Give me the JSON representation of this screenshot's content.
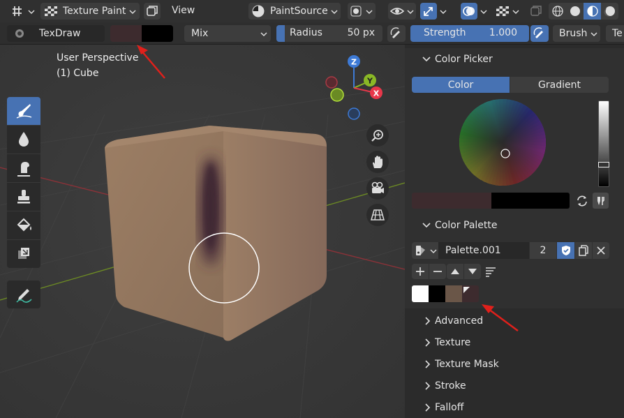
{
  "header": {
    "mode_label": "Texture Paint",
    "view_menu": "View",
    "source_label": "PaintSource"
  },
  "toolsettings": {
    "brush_name": "TexDraw",
    "blend_mode": "Mix",
    "radius_label": "Radius",
    "radius_value": "50 px",
    "strength_label": "Strength",
    "strength_value": "1.000",
    "strength_fill": 1.0,
    "radius_fill": 0.08,
    "brush_menu": "Brush",
    "texture_menu_partial": "Te",
    "primary_color": "#3d2b2e",
    "secondary_color": "#000000"
  },
  "viewport": {
    "perspective_label": "User Perspective",
    "object_label": "(1) Cube",
    "gizmo": {
      "z": "Z",
      "y": "Y",
      "x": "X"
    }
  },
  "sidebar": {
    "color_picker": {
      "title": "Color Picker",
      "tabs": [
        "Color",
        "Gradient"
      ],
      "active_tab": "Color",
      "primary": "#3d2b2e",
      "secondary": "#000000"
    },
    "color_palette": {
      "title": "Color Palette",
      "palette_name": "Palette.001",
      "users_count": "2",
      "swatches": [
        "#ffffff",
        "#000000",
        "#6a5648",
        "#3d2b2e"
      ]
    },
    "collapsed_panels": [
      "Advanced",
      "Texture",
      "Texture Mask",
      "Stroke",
      "Falloff"
    ]
  },
  "colors": {
    "accent": "#4772b3",
    "annotation": "#e0201b",
    "axis_x": "#e8374a",
    "axis_y": "#8ab826",
    "axis_z": "#3d7ad6"
  }
}
